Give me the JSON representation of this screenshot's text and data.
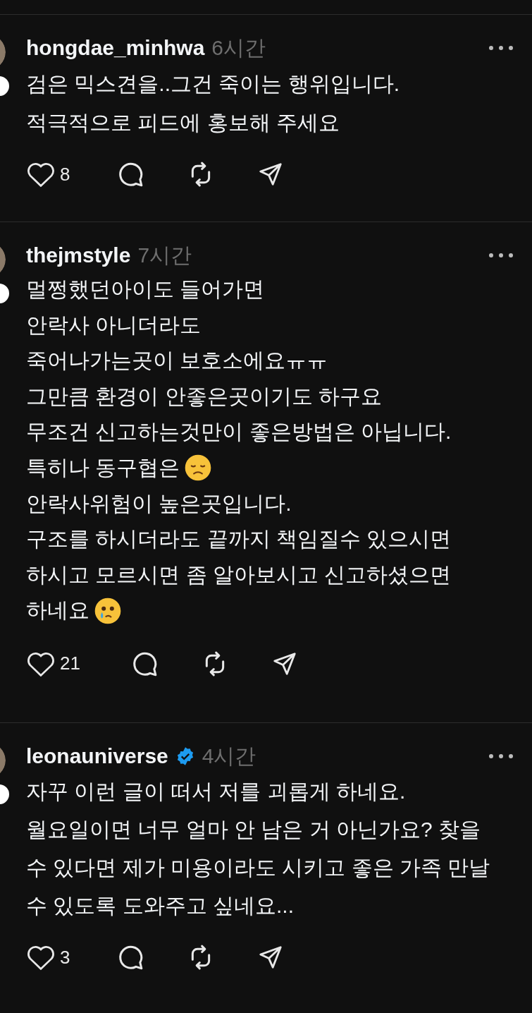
{
  "posts": [
    {
      "username": "hongdae_minhwa",
      "verified": false,
      "time": "6시간",
      "lines": [
        {
          "kind": "plain",
          "text": "검은 믹스견을..그건 죽이는 행위입니다."
        },
        {
          "kind": "plain",
          "text": "적극적으로 피드에 홍보해 주세요"
        }
      ],
      "likes": "8"
    },
    {
      "username": "thejmstyle",
      "verified": false,
      "time": "7시간",
      "lines": [
        {
          "kind": "plain",
          "text": "멀쩡했던아이도 들어가면"
        },
        {
          "kind": "plain",
          "text": "안락사 아니더라도"
        },
        {
          "kind": "plain",
          "text": "죽어나가는곳이 보호소에요ㅠㅠ"
        },
        {
          "kind": "plain",
          "text": "그만큼 환경이 안좋은곳이기도 하구요"
        },
        {
          "kind": "plain",
          "text": "무조건 신고하는것만이 좋은방법은 아닙니다."
        },
        {
          "kind": "sad",
          "text": "특히나 동구협은"
        },
        {
          "kind": "plain",
          "text": "안락사위험이 높은곳입니다."
        },
        {
          "kind": "plain",
          "text": "구조를 하시더라도 끝까지 책임질수 있으시면"
        },
        {
          "kind": "plain",
          "text": "하시고 모르시면 좀 알아보시고 신고하셨으면"
        },
        {
          "kind": "crying",
          "text": "하네요"
        }
      ],
      "likes": "21"
    },
    {
      "username": "leonauniverse",
      "verified": true,
      "time": "4시간",
      "lines": [
        {
          "kind": "plain",
          "text": "자꾸 이런 글이 떠서 저를 괴롭게 하네요."
        },
        {
          "kind": "plain",
          "text": "월요일이면 너무 얼마 안 남은 거 아닌가요? 찾을"
        },
        {
          "kind": "plain",
          "text": "수 있다면 제가 미용이라도 시키고 좋은 가족 만날"
        },
        {
          "kind": "plain",
          "text": "수 있도록 도와주고 싶네요..."
        }
      ],
      "likes": "3"
    }
  ]
}
